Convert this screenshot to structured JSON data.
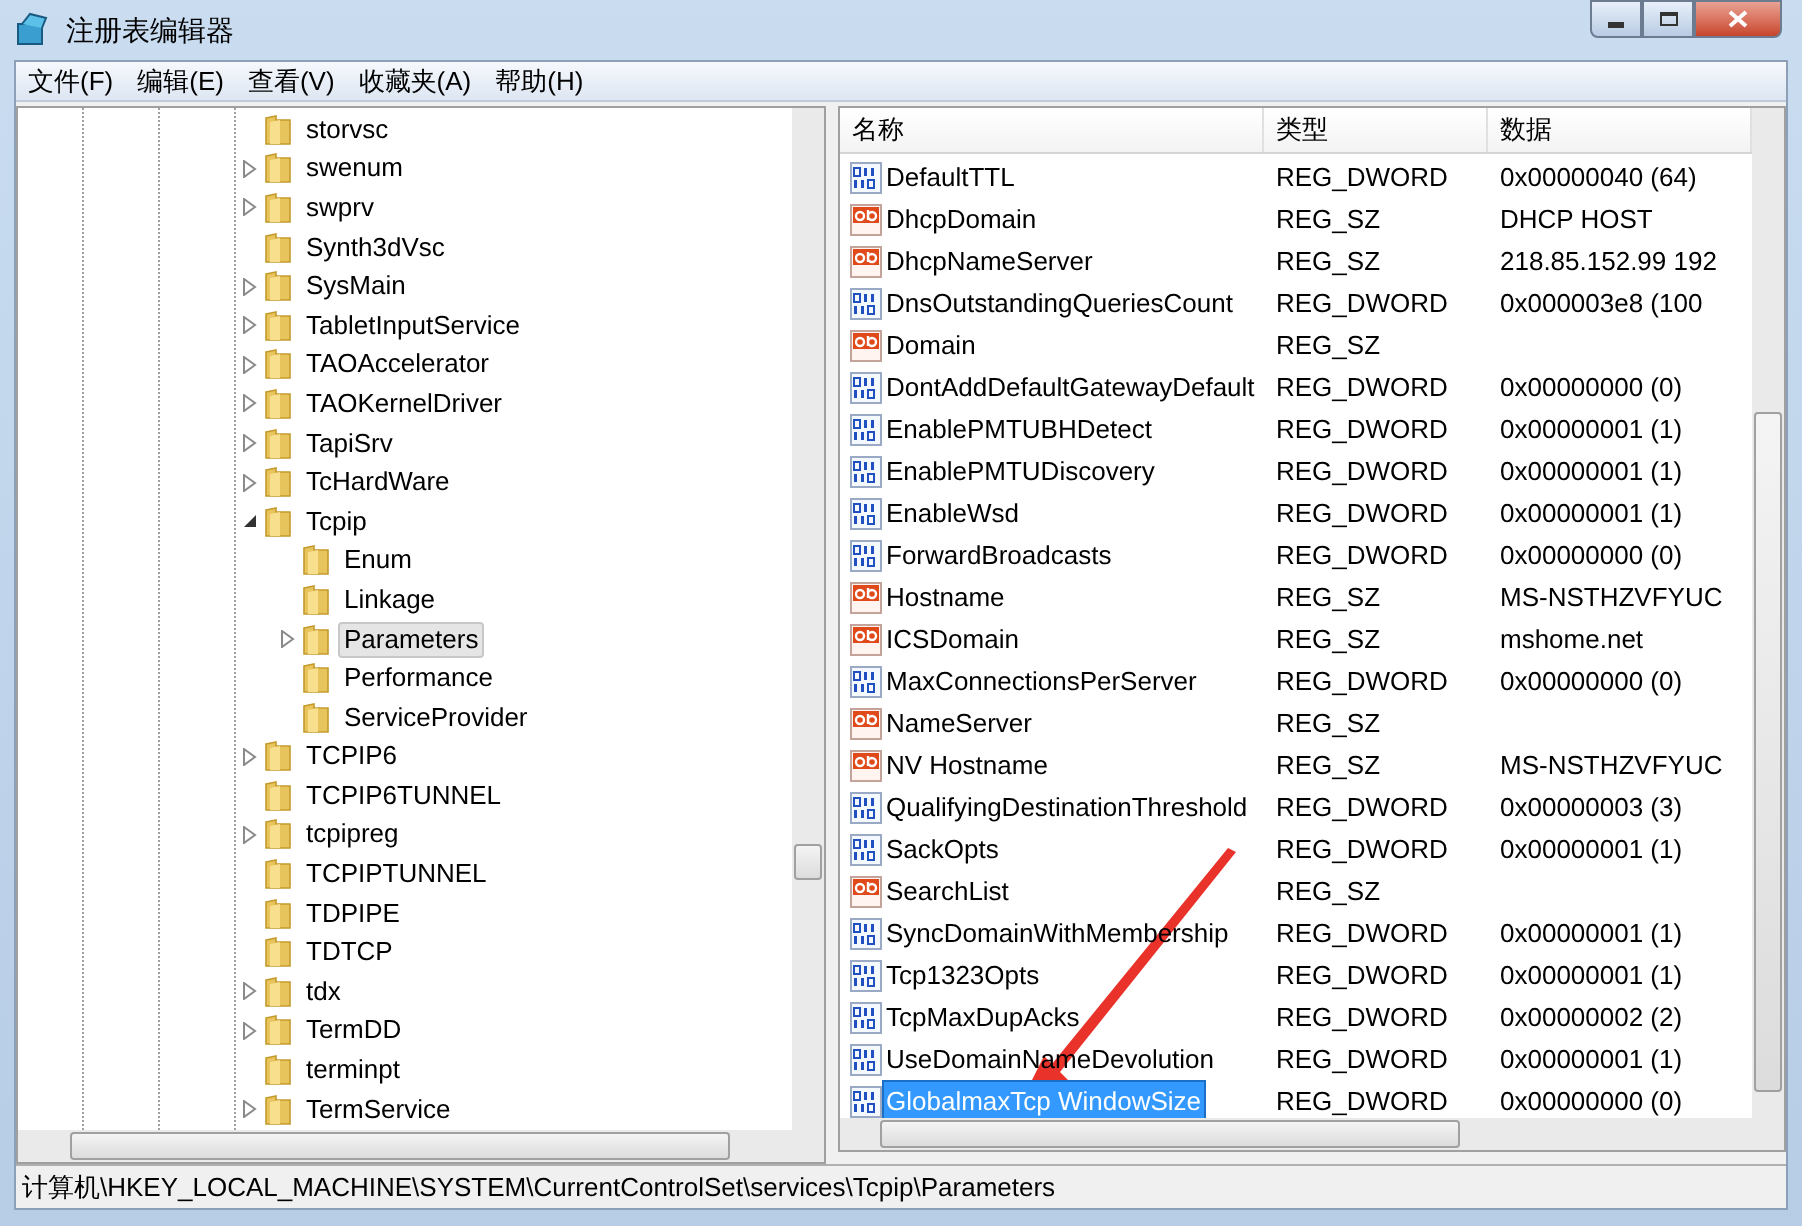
{
  "window": {
    "title": "注册表编辑器"
  },
  "menu": [
    "文件(F)",
    "编辑(E)",
    "查看(V)",
    "收藏夹(A)",
    "帮助(H)"
  ],
  "tree": [
    {
      "label": "storvsc",
      "kind": "leaf",
      "selected": false
    },
    {
      "label": "swenum",
      "kind": "collapsed",
      "selected": false
    },
    {
      "label": "swprv",
      "kind": "collapsed",
      "selected": false
    },
    {
      "label": "Synth3dVsc",
      "kind": "leaf",
      "selected": false
    },
    {
      "label": "SysMain",
      "kind": "collapsed",
      "selected": false
    },
    {
      "label": "TabletInputService",
      "kind": "collapsed",
      "selected": false
    },
    {
      "label": "TAOAccelerator",
      "kind": "collapsed",
      "selected": false
    },
    {
      "label": "TAOKernelDriver",
      "kind": "collapsed",
      "selected": false
    },
    {
      "label": "TapiSrv",
      "kind": "collapsed",
      "selected": false
    },
    {
      "label": "TcHardWare",
      "kind": "collapsed",
      "selected": false
    },
    {
      "label": "Tcpip",
      "kind": "expanded",
      "selected": false,
      "children": [
        {
          "label": "Enum",
          "kind": "leaf",
          "selected": false
        },
        {
          "label": "Linkage",
          "kind": "leaf",
          "selected": false
        },
        {
          "label": "Parameters",
          "kind": "collapsed",
          "selected": true
        },
        {
          "label": "Performance",
          "kind": "leaf",
          "selected": false
        },
        {
          "label": "ServiceProvider",
          "kind": "leaf",
          "selected": false
        }
      ]
    },
    {
      "label": "TCPIP6",
      "kind": "collapsed",
      "selected": false
    },
    {
      "label": "TCPIP6TUNNEL",
      "kind": "leaf",
      "selected": false
    },
    {
      "label": "tcpipreg",
      "kind": "collapsed",
      "selected": false
    },
    {
      "label": "TCPIPTUNNEL",
      "kind": "leaf",
      "selected": false
    },
    {
      "label": "TDPIPE",
      "kind": "leaf",
      "selected": false
    },
    {
      "label": "TDTCP",
      "kind": "leaf",
      "selected": false
    },
    {
      "label": "tdx",
      "kind": "collapsed",
      "selected": false
    },
    {
      "label": "TermDD",
      "kind": "collapsed",
      "selected": false
    },
    {
      "label": "terminpt",
      "kind": "leaf",
      "selected": false
    },
    {
      "label": "TermService",
      "kind": "collapsed",
      "selected": false
    }
  ],
  "table": {
    "columns": [
      "名称",
      "类型",
      "数据"
    ],
    "rows": [
      {
        "kind": "dword",
        "name": "DefaultTTL",
        "type": "REG_DWORD",
        "data": "0x00000040 (64)",
        "selected": false
      },
      {
        "kind": "sz",
        "name": "DhcpDomain",
        "type": "REG_SZ",
        "data": "DHCP HOST",
        "selected": false
      },
      {
        "kind": "sz",
        "name": "DhcpNameServer",
        "type": "REG_SZ",
        "data": "218.85.152.99 192",
        "selected": false
      },
      {
        "kind": "dword",
        "name": "DnsOutstandingQueriesCount",
        "type": "REG_DWORD",
        "data": "0x000003e8 (100",
        "selected": false
      },
      {
        "kind": "sz",
        "name": "Domain",
        "type": "REG_SZ",
        "data": "",
        "selected": false
      },
      {
        "kind": "dword",
        "name": "DontAddDefaultGatewayDefault",
        "type": "REG_DWORD",
        "data": "0x00000000 (0)",
        "selected": false
      },
      {
        "kind": "dword",
        "name": "EnablePMTUBHDetect",
        "type": "REG_DWORD",
        "data": "0x00000001 (1)",
        "selected": false
      },
      {
        "kind": "dword",
        "name": "EnablePMTUDiscovery",
        "type": "REG_DWORD",
        "data": "0x00000001 (1)",
        "selected": false
      },
      {
        "kind": "dword",
        "name": "EnableWsd",
        "type": "REG_DWORD",
        "data": "0x00000001 (1)",
        "selected": false
      },
      {
        "kind": "dword",
        "name": "ForwardBroadcasts",
        "type": "REG_DWORD",
        "data": "0x00000000 (0)",
        "selected": false
      },
      {
        "kind": "sz",
        "name": "Hostname",
        "type": "REG_SZ",
        "data": "MS-NSTHZVFYUC",
        "selected": false
      },
      {
        "kind": "sz",
        "name": "ICSDomain",
        "type": "REG_SZ",
        "data": "mshome.net",
        "selected": false
      },
      {
        "kind": "dword",
        "name": "MaxConnectionsPerServer",
        "type": "REG_DWORD",
        "data": "0x00000000 (0)",
        "selected": false
      },
      {
        "kind": "sz",
        "name": "NameServer",
        "type": "REG_SZ",
        "data": "",
        "selected": false
      },
      {
        "kind": "sz",
        "name": "NV Hostname",
        "type": "REG_SZ",
        "data": "MS-NSTHZVFYUC",
        "selected": false
      },
      {
        "kind": "dword",
        "name": "QualifyingDestinationThreshold",
        "type": "REG_DWORD",
        "data": "0x00000003 (3)",
        "selected": false
      },
      {
        "kind": "dword",
        "name": "SackOpts",
        "type": "REG_DWORD",
        "data": "0x00000001 (1)",
        "selected": false
      },
      {
        "kind": "sz",
        "name": "SearchList",
        "type": "REG_SZ",
        "data": "",
        "selected": false
      },
      {
        "kind": "dword",
        "name": "SyncDomainWithMembership",
        "type": "REG_DWORD",
        "data": "0x00000001 (1)",
        "selected": false
      },
      {
        "kind": "dword",
        "name": "Tcp1323Opts",
        "type": "REG_DWORD",
        "data": "0x00000001 (1)",
        "selected": false
      },
      {
        "kind": "dword",
        "name": "TcpMaxDupAcks",
        "type": "REG_DWORD",
        "data": "0x00000002 (2)",
        "selected": false
      },
      {
        "kind": "dword",
        "name": "UseDomainNameDevolution",
        "type": "REG_DWORD",
        "data": "0x00000001 (1)",
        "selected": false
      },
      {
        "kind": "dword",
        "name": "GlobalmaxTcp WindowSize",
        "type": "REG_DWORD",
        "data": "0x00000000 (0)",
        "selected": true
      }
    ]
  },
  "status_bar": "计算机\\HKEY_LOCAL_MACHINE\\SYSTEM\\CurrentControlSet\\services\\Tcpip\\Parameters"
}
